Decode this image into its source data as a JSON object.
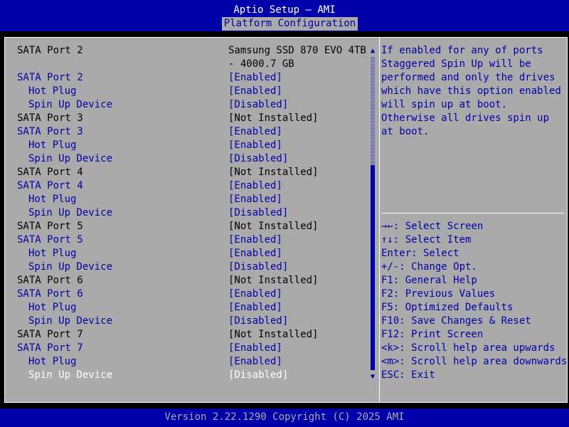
{
  "header": {
    "title": "Aptio Setup – AMI",
    "active_tab": "Platform Configuration"
  },
  "settings": [
    {
      "label": "SATA Port 2",
      "value": "Samsung SSD 870 EVO 4TB",
      "value2": "- 4000.7 GB",
      "type": "info"
    },
    {
      "label": "SATA Port 2",
      "value": "[Enabled]",
      "type": "sel"
    },
    {
      "label": "Hot Plug",
      "value": "[Enabled]",
      "type": "sel",
      "indent": true
    },
    {
      "label": "Spin Up Device",
      "value": "[Disabled]",
      "type": "sel",
      "indent": true
    },
    {
      "label": "SATA Port 3",
      "value": "[Not Installed]",
      "type": "info"
    },
    {
      "label": "SATA Port 3",
      "value": "[Enabled]",
      "type": "sel"
    },
    {
      "label": "Hot Plug",
      "value": "[Enabled]",
      "type": "sel",
      "indent": true
    },
    {
      "label": "Spin Up Device",
      "value": "[Disabled]",
      "type": "sel",
      "indent": true
    },
    {
      "label": "SATA Port 4",
      "value": "[Not Installed]",
      "type": "info"
    },
    {
      "label": "SATA Port 4",
      "value": "[Enabled]",
      "type": "sel"
    },
    {
      "label": "Hot Plug",
      "value": "[Enabled]",
      "type": "sel",
      "indent": true
    },
    {
      "label": "Spin Up Device",
      "value": "[Disabled]",
      "type": "sel",
      "indent": true
    },
    {
      "label": "SATA Port 5",
      "value": "[Not Installed]",
      "type": "info"
    },
    {
      "label": "SATA Port 5",
      "value": "[Enabled]",
      "type": "sel"
    },
    {
      "label": "Hot Plug",
      "value": "[Enabled]",
      "type": "sel",
      "indent": true
    },
    {
      "label": "Spin Up Device",
      "value": "[Disabled]",
      "type": "sel",
      "indent": true
    },
    {
      "label": "SATA Port 6",
      "value": "[Not Installed]",
      "type": "info"
    },
    {
      "label": "SATA Port 6",
      "value": "[Enabled]",
      "type": "sel"
    },
    {
      "label": "Hot Plug",
      "value": "[Enabled]",
      "type": "sel",
      "indent": true
    },
    {
      "label": "Spin Up Device",
      "value": "[Disabled]",
      "type": "sel",
      "indent": true
    },
    {
      "label": "SATA Port 7",
      "value": "[Not Installed]",
      "type": "info"
    },
    {
      "label": "SATA Port 7",
      "value": "[Enabled]",
      "type": "sel"
    },
    {
      "label": "Hot Plug",
      "value": "[Enabled]",
      "type": "sel",
      "indent": true
    },
    {
      "label": "Spin Up Device",
      "value": "[Disabled]",
      "type": "cur",
      "indent": true
    }
  ],
  "help": [
    "If enabled for any of ports",
    "Staggered Spin Up will be",
    "performed and only the drives",
    "which have this option enabled",
    "will spin up at boot.",
    "Otherwise all drives spin up",
    "at boot."
  ],
  "keys": [
    "→←: Select Screen",
    "↑↓: Select Item",
    "Enter: Select",
    "+/-: Change Opt.",
    "F1: General Help",
    "F2: Previous Values",
    "F5: Optimized Defaults",
    "F10: Save Changes & Reset",
    "F12: Print Screen",
    "<k>: Scroll help area upwards",
    "<m>: Scroll help area downwards",
    "ESC: Exit"
  ],
  "scrollbar": {
    "up_icon": "▲",
    "down_icon": "▼",
    "thumb_position": 0.35
  },
  "footer": "Version 2.22.1290 Copyright (C) 2025 AMI",
  "colors": {
    "blue": "#0000a8",
    "gray": "#aaaaaa",
    "white": "#ffffff",
    "black": "#000000"
  }
}
